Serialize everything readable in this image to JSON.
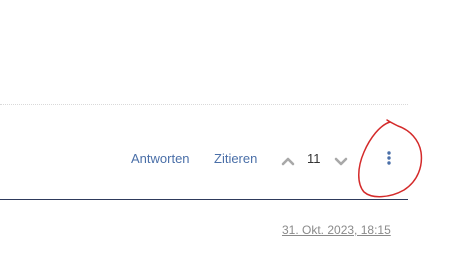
{
  "post_actions": {
    "reply_label": "Antworten",
    "quote_label": "Zitieren",
    "vote_count": "11",
    "upvote_icon": "chevron-up-icon",
    "downvote_icon": "chevron-down-icon",
    "more_icon": "vertical-ellipsis-icon"
  },
  "next_post": {
    "timestamp": "31. Okt. 2023, 18:15"
  },
  "colors": {
    "link": "#4a6fa8",
    "icon_grey": "#a8a8a8",
    "more_icon": "#4a6fa8",
    "rule": "#2e3a5c",
    "annotation": "#d42a2a",
    "timestamp": "#8a8a8a"
  }
}
